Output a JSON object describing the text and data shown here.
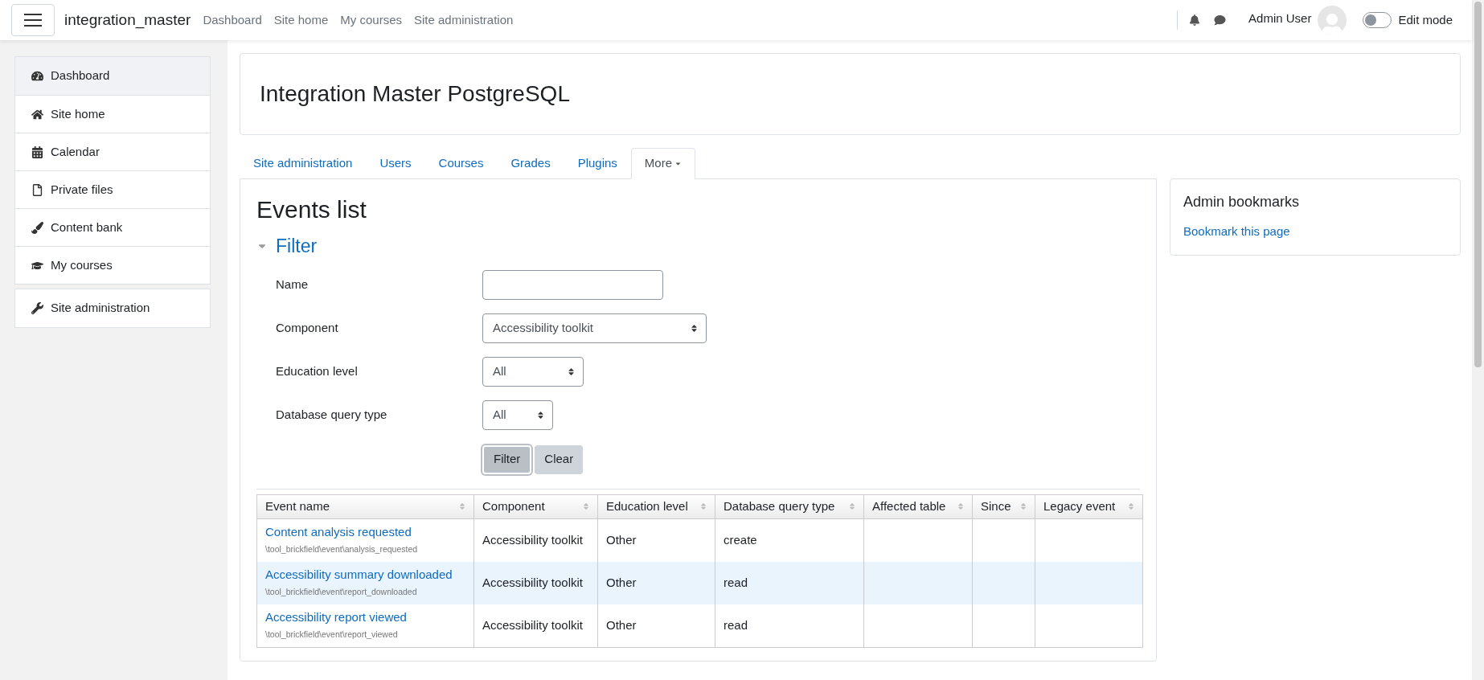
{
  "navbar": {
    "site_name": "integration_master",
    "links": [
      "Dashboard",
      "Site home",
      "My courses",
      "Site administration"
    ],
    "user_name": "Admin User",
    "edit_mode": {
      "label": "Edit mode",
      "on": false
    }
  },
  "sidebar": {
    "groups": [
      [
        {
          "label": "Dashboard",
          "selected": true
        },
        {
          "label": "Site home",
          "selected": false
        },
        {
          "label": "Calendar",
          "selected": false
        },
        {
          "label": "Private files",
          "selected": false
        },
        {
          "label": "Content bank",
          "selected": false
        },
        {
          "label": "My courses",
          "selected": false
        }
      ],
      [
        {
          "label": "Site administration",
          "selected": false
        }
      ]
    ]
  },
  "page_header": {
    "title": "Integration Master PostgreSQL"
  },
  "tabs": [
    {
      "label": "Site administration",
      "selected": false,
      "dropdown": false
    },
    {
      "label": "Users",
      "selected": false,
      "dropdown": false
    },
    {
      "label": "Courses",
      "selected": false,
      "dropdown": false
    },
    {
      "label": "Grades",
      "selected": false,
      "dropdown": false
    },
    {
      "label": "Plugins",
      "selected": false,
      "dropdown": false
    },
    {
      "label": "More",
      "selected": true,
      "dropdown": true
    }
  ],
  "content": {
    "heading": "Events list",
    "filter": {
      "title": "Filter",
      "expanded": true,
      "fields": [
        {
          "label": "Name",
          "kind": "text"
        },
        {
          "label": "Component",
          "kind": "select",
          "value": "Accessibility toolkit"
        },
        {
          "label": "Education level",
          "kind": "select",
          "value": "All"
        },
        {
          "label": "Database query type",
          "kind": "select",
          "value": "All"
        }
      ],
      "buttons": [
        {
          "label": "Filter",
          "focused": true
        },
        {
          "label": "Clear",
          "focused": false
        }
      ]
    },
    "table": {
      "columns": [
        "Event name",
        "Component",
        "Education level",
        "Database query type",
        "Affected table",
        "Since",
        "Legacy event"
      ],
      "rows": [
        {
          "event_name": "Content analysis requested",
          "event_path": "\\tool_brickfield\\event\\analysis_requested",
          "component": "Accessibility toolkit",
          "education_level": "Other",
          "query_type": "create",
          "highlighted": false
        },
        {
          "event_name": "Accessibility summary downloaded",
          "event_path": "\\tool_brickfield\\event\\report_downloaded",
          "component": "Accessibility toolkit",
          "education_level": "Other",
          "query_type": "read",
          "highlighted": true
        },
        {
          "event_name": "Accessibility report viewed",
          "event_path": "\\tool_brickfield\\event\\report_viewed",
          "component": "Accessibility toolkit",
          "education_level": "Other",
          "query_type": "read",
          "highlighted": false
        }
      ]
    }
  },
  "block": {
    "title": "Admin bookmarks",
    "link": "Bookmark this page"
  }
}
